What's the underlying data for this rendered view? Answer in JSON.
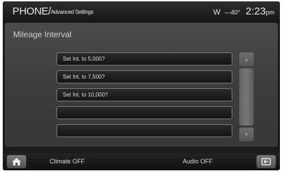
{
  "header": {
    "title_main": "PHONE/",
    "title_sub": "Advanced Settings",
    "compass": "W",
    "temperature": "—40°",
    "clock": "2:23",
    "ampm": "pm"
  },
  "panel": {
    "title": "Mileage Interval",
    "options": [
      {
        "label": "Set Int. to 5,000?"
      },
      {
        "label": "Set Int. to 7,500?"
      },
      {
        "label": "Set Int. to 10,000?"
      },
      {
        "label": ""
      },
      {
        "label": ""
      }
    ],
    "scroll_up_icon": "arrow-up-icon",
    "scroll_down_icon": "arrow-down-icon"
  },
  "footer": {
    "home_icon": "home-icon",
    "climate_label": "Climate OFF",
    "audio_label": "Audio OFF",
    "back_icon": "back-icon"
  }
}
